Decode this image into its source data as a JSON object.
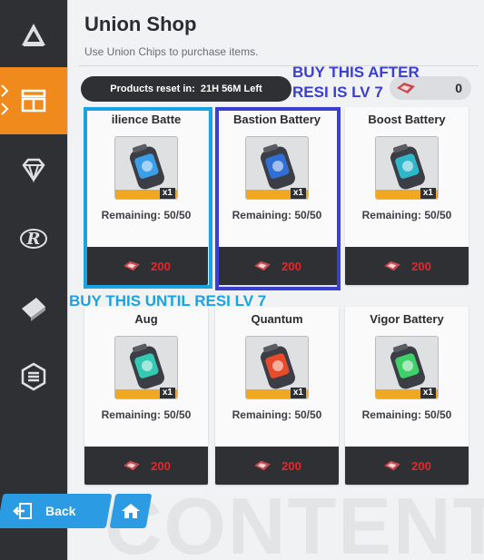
{
  "header": {
    "title": "Union Shop",
    "subtitle": "Use Union Chips to purchase items."
  },
  "reset": {
    "label": "Products reset in:",
    "time": "21H 56M Left"
  },
  "currency": {
    "count": "0",
    "icon": "union-chip-icon"
  },
  "sidebar": {
    "items": [
      {
        "name": "shop-home-icon"
      },
      {
        "name": "union-shop-icon",
        "active": true
      },
      {
        "name": "gem-icon"
      },
      {
        "name": "r-logo-icon"
      },
      {
        "name": "ticket-icon"
      },
      {
        "name": "hex-badge-icon"
      }
    ]
  },
  "cards": [
    {
      "name": "ilience Batte",
      "remaining": "Remaining: 50/50",
      "price": "200",
      "qty": "x1",
      "color": "#3a9ee8"
    },
    {
      "name": "Bastion Battery",
      "remaining": "Remaining: 50/50",
      "price": "200",
      "qty": "x1",
      "color": "#2f6fd6"
    },
    {
      "name": "Boost Battery",
      "remaining": "Remaining: 50/50",
      "price": "200",
      "qty": "x1",
      "color": "#2fb7c9"
    },
    {
      "name": "Aug",
      "remaining": "Remaining: 50/50",
      "price": "200",
      "qty": "x1",
      "color": "#35c9b4"
    },
    {
      "name": "Quantum",
      "remaining": "Remaining: 50/50",
      "price": "200",
      "qty": "x1",
      "color": "#e84a2a"
    },
    {
      "name": "Vigor Battery",
      "remaining": "Remaining: 50/50",
      "price": "200",
      "qty": "x1",
      "color": "#3fd06a"
    }
  ],
  "annotations": {
    "after_line1": "BUY THIS AFTER",
    "after_line2": "RESI IS LV 7",
    "until": "BUY THIS UNTIL RESI LV 7",
    "after_color": "#3b3fd1",
    "until_color": "#1aa3e0"
  },
  "footer": {
    "back_label": "Back",
    "watermark": "CONTENT"
  }
}
